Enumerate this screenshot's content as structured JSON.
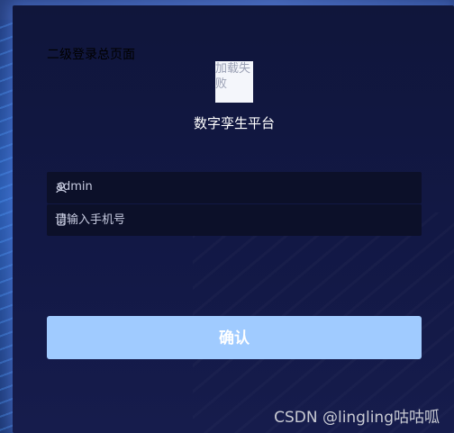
{
  "page": {
    "title": "二级登录总页面"
  },
  "logo": {
    "alt_text": "加载失败"
  },
  "platform": {
    "name": "数字孪生平台"
  },
  "form": {
    "username_value": "admin",
    "phone_placeholder": "请输入手机号",
    "user_icon": "user-icon",
    "phone_icon": "phone-icon"
  },
  "actions": {
    "confirm_label": "确认"
  },
  "watermark": {
    "text": "CSDN @lingling咕咕呱"
  },
  "colors": {
    "panel_bg": "#121845",
    "field_bg": "#0c1029",
    "button_bg": "#a0cbff",
    "glow": "#5a82e6"
  }
}
